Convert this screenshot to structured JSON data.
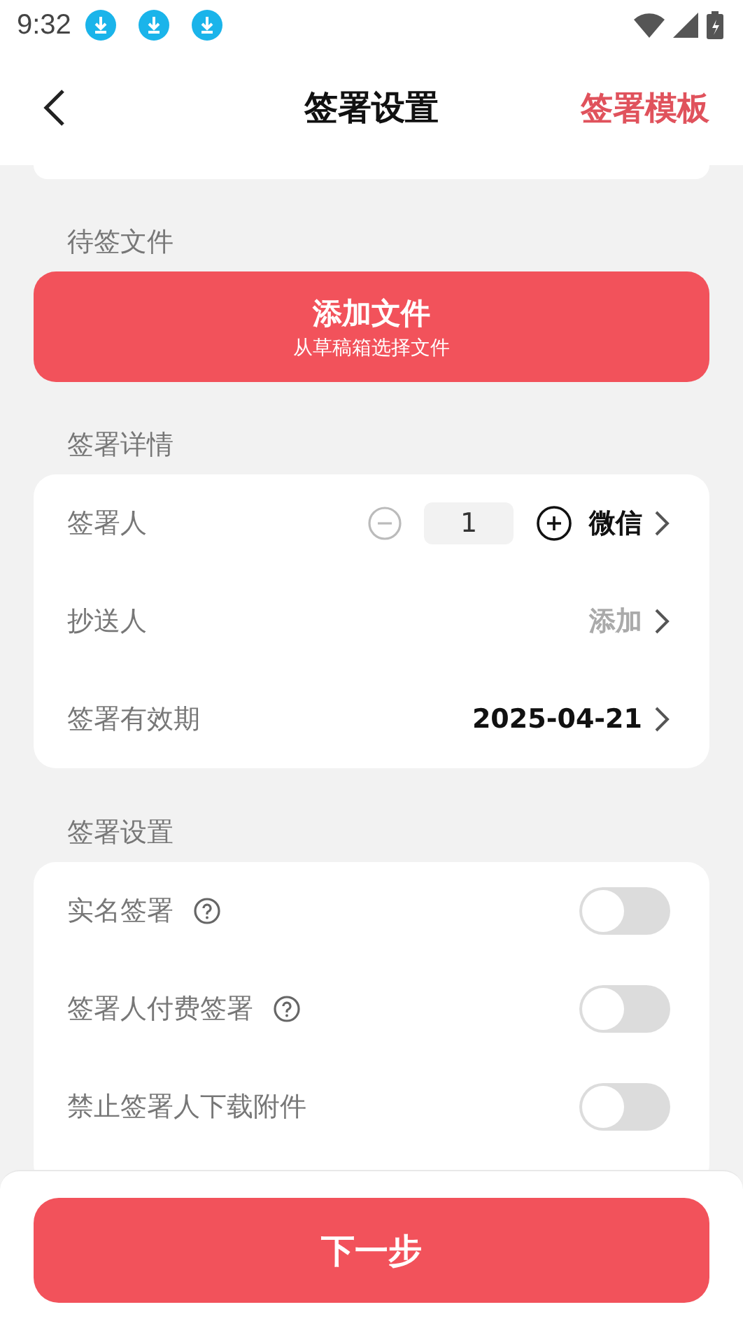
{
  "status_bar": {
    "time": "9:32",
    "notifications": [
      {
        "kind": "download"
      },
      {
        "kind": "download"
      },
      {
        "kind": "download"
      }
    ]
  },
  "header": {
    "title": "签署设置",
    "action": "签署模板"
  },
  "files_section": {
    "label": "待签文件",
    "button": {
      "title": "添加文件",
      "subtitle": "从草稿箱选择文件"
    }
  },
  "details_section": {
    "label": "签署详情",
    "rows": [
      {
        "kind": "stepper",
        "label": "签署人",
        "count": "1",
        "value": "微信"
      },
      {
        "kind": "link",
        "label": "抄送人",
        "value": "添加"
      },
      {
        "kind": "value",
        "label": "签署有效期",
        "value": "2025-04-21"
      }
    ]
  },
  "settings_section": {
    "label": "签署设置",
    "rows": [
      {
        "label": "实名签署",
        "help": true,
        "on": false
      },
      {
        "label": "签署人付费签署",
        "help": true,
        "on": false
      },
      {
        "label": "禁止签署人下载附件",
        "help": false,
        "on": false
      }
    ]
  },
  "footer": {
    "button": "下一步"
  }
}
